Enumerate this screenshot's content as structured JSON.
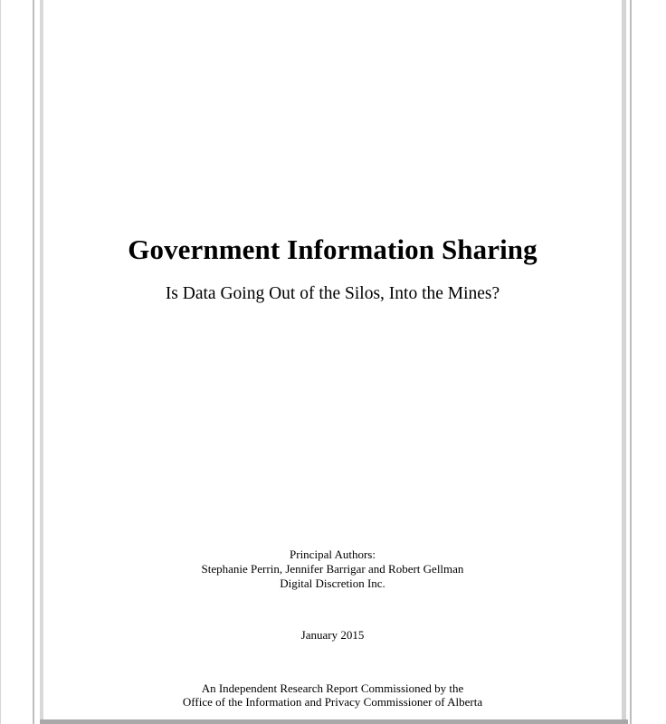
{
  "document": {
    "title": "Government Information Sharing",
    "subtitle": "Is Data Going Out of the Silos, Into the Mines?",
    "authors": {
      "heading": "Principal Authors:",
      "names": "Stephanie Perrin, Jennifer Barrigar and Robert Gellman",
      "organization": "Digital Discretion Inc."
    },
    "date": "January 2015",
    "commission": {
      "line1": "An Independent Research Report Commissioned by the",
      "line2": "Office of the Information and Privacy Commissioner of Alberta"
    }
  }
}
